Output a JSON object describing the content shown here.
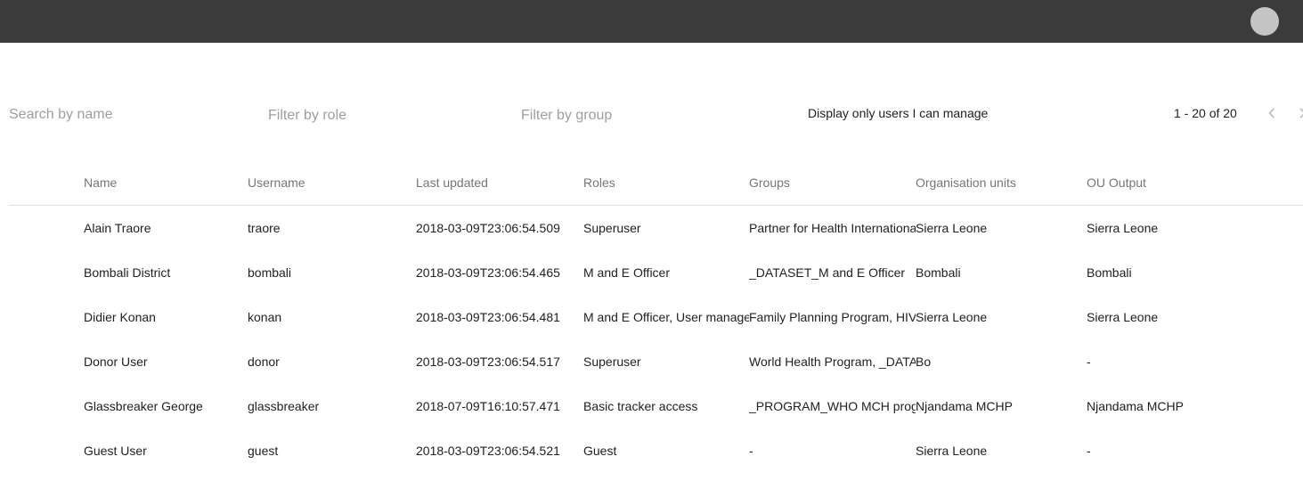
{
  "header": {
    "avatar_icon": "user-avatar-icon"
  },
  "filters": {
    "search_placeholder": "Search by name",
    "role_placeholder": "Filter by role",
    "group_placeholder": "Filter by group",
    "manage_label": "Display only users I can manage"
  },
  "pagination": {
    "range": "1 - 20 of 20",
    "prev_icon": "chevron-left-icon",
    "next_icon": "chevron-right-icon"
  },
  "table": {
    "columns": [
      "Name",
      "Username",
      "Last updated",
      "Roles",
      "Groups",
      "Organisation units",
      "OU Output"
    ],
    "rows": [
      [
        "Alain Traore",
        "traore",
        "2018-03-09T23:06:54.509",
        "Superuser",
        "Partner for Health International",
        "Sierra Leone",
        "Sierra Leone"
      ],
      [
        "Bombali District",
        "bombali",
        "2018-03-09T23:06:54.465",
        "M and E Officer",
        "_DATASET_M and E Officer",
        "Bombali",
        "Bombali"
      ],
      [
        "Didier Konan",
        "konan",
        "2018-03-09T23:06:54.481",
        "M and E Officer, User manager",
        "Family Planning Program, HIV",
        "Sierra Leone",
        "Sierra Leone"
      ],
      [
        "Donor User",
        "donor",
        "2018-03-09T23:06:54.517",
        "Superuser",
        "World Health Program, _DATASET",
        "Bo",
        "-"
      ],
      [
        "Glassbreaker George",
        "glassbreaker",
        "2018-07-09T16:10:57.471",
        "Basic tracker access",
        "_PROGRAM_WHO MCH program",
        "Njandama MCHP",
        "Njandama MCHP"
      ],
      [
        "Guest User",
        "guest",
        "2018-03-09T23:06:54.521",
        "Guest",
        "-",
        "Sierra Leone",
        "-"
      ]
    ]
  }
}
